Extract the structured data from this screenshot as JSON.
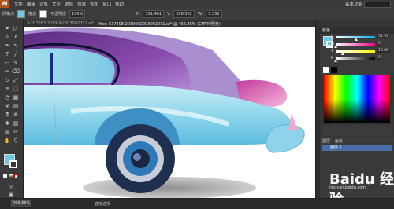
{
  "menubar": {
    "logo": "Ai",
    "items": [
      "文件",
      "编辑",
      "对象",
      "文字",
      "选择",
      "效果",
      "视图",
      "窗口",
      "帮助"
    ],
    "workspace": "基本功能"
  },
  "control": {
    "mode_label": "网格点",
    "swatch_color": "#6ec9e6",
    "stroke_label": "描边",
    "opacity_label": "不透明度",
    "opacity_value": "100%",
    "x_value": "351.461",
    "y_value": "288.562",
    "w_value": "9.351"
  },
  "tabs": [
    {
      "label": "%2C7283 2019002003002011.ai*",
      "active": false
    },
    {
      "label": "Hps: 537398 2019002003002011.ai* @ 466.86% (CMYK/预览)",
      "active": true
    }
  ],
  "color_panel": {
    "title": "颜色",
    "channels": [
      {
        "name": "C",
        "value": "51.53",
        "gradient": [
          "#ffffff",
          "#00aeef"
        ],
        "level": 0.52
      },
      {
        "name": "M",
        "value": "0",
        "gradient": [
          "#ffffff",
          "#ec008c"
        ],
        "level": 0.0
      },
      {
        "name": "Y",
        "value": "16.68",
        "gradient": [
          "#ffffff",
          "#fff200"
        ],
        "level": 0.17
      },
      {
        "name": "K",
        "value": "0",
        "gradient": [
          "#ffffff",
          "#000000"
        ],
        "level": 0.0
      }
    ],
    "fill_color": "#6ec9e6"
  },
  "layers_panel": {
    "tabs": [
      "图层",
      "画板"
    ],
    "layer_name": "图层 1"
  },
  "status": {
    "zoom": "466.86%",
    "page": "1",
    "info": "直接选择"
  },
  "watermark": {
    "text": "Baidu 经验",
    "url": "jingyan.baidu.com"
  },
  "art_colors": {
    "roof_purple": "#7b3f9a",
    "roof_light": "#a989cf",
    "body_cyan": "#6ec9e6",
    "body_light": "#b8e6f2",
    "window_blue": "#0e2a7a",
    "taillight_pink": "#e85aa8",
    "wheel_dark": "#1f2f4f",
    "rim_blue": "#2e7ab8",
    "shadow_gray": "#9a9a9a"
  }
}
